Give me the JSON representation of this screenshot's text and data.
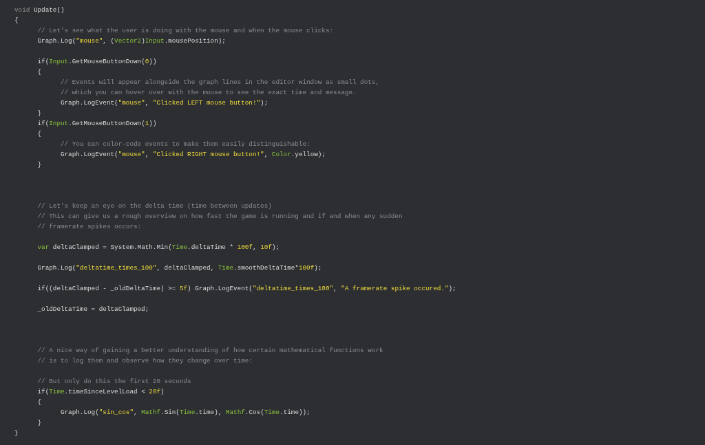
{
  "editor": {
    "lines": [
      {
        "kind": "code",
        "tokens": [
          {
            "kind": "keyword",
            "text": "void"
          },
          {
            "kind": "plain",
            "text": " Update()"
          }
        ]
      },
      {
        "kind": "code",
        "tokens": [
          {
            "kind": "plain",
            "text": "{"
          }
        ]
      },
      {
        "kind": "code",
        "tokens": [
          {
            "kind": "comment",
            "text": "\t// Let's see what the user is doing with the mouse and when the mouse clicks:"
          }
        ]
      },
      {
        "kind": "code",
        "tokens": [
          {
            "kind": "plain",
            "text": "\tGraph.Log("
          },
          {
            "kind": "string",
            "text": "\"mouse\""
          },
          {
            "kind": "plain",
            "text": ", ("
          },
          {
            "kind": "type",
            "text": "Vector2"
          },
          {
            "kind": "plain",
            "text": ")"
          },
          {
            "kind": "type",
            "text": "Input"
          },
          {
            "kind": "plain",
            "text": ".mousePosition);"
          }
        ]
      },
      {
        "kind": "blank"
      },
      {
        "kind": "code",
        "tokens": [
          {
            "kind": "plain",
            "text": "\tif("
          },
          {
            "kind": "type",
            "text": "Input"
          },
          {
            "kind": "plain",
            "text": ".GetMouseButtonDown("
          },
          {
            "kind": "number",
            "text": "0"
          },
          {
            "kind": "plain",
            "text": "))"
          }
        ]
      },
      {
        "kind": "code",
        "tokens": [
          {
            "kind": "plain",
            "text": "\t{"
          }
        ]
      },
      {
        "kind": "code",
        "tokens": [
          {
            "kind": "comment",
            "text": "\t\t// Events will appear alongside the graph lines in the editor window as small dots,"
          }
        ]
      },
      {
        "kind": "code",
        "tokens": [
          {
            "kind": "comment",
            "text": "\t\t// which you can hover over with the mouse to see the exact time and message."
          }
        ]
      },
      {
        "kind": "code",
        "tokens": [
          {
            "kind": "plain",
            "text": "\t\tGraph.LogEvent("
          },
          {
            "kind": "string",
            "text": "\"mouse\""
          },
          {
            "kind": "plain",
            "text": ", "
          },
          {
            "kind": "string",
            "text": "\"Clicked LEFT mouse button!\""
          },
          {
            "kind": "plain",
            "text": ");"
          }
        ]
      },
      {
        "kind": "code",
        "tokens": [
          {
            "kind": "plain",
            "text": "\t}"
          }
        ]
      },
      {
        "kind": "code",
        "tokens": [
          {
            "kind": "plain",
            "text": "\tif("
          },
          {
            "kind": "type",
            "text": "Input"
          },
          {
            "kind": "plain",
            "text": ".GetMouseButtonDown("
          },
          {
            "kind": "number",
            "text": "1"
          },
          {
            "kind": "plain",
            "text": "))"
          }
        ]
      },
      {
        "kind": "code",
        "tokens": [
          {
            "kind": "plain",
            "text": "\t{"
          }
        ]
      },
      {
        "kind": "code",
        "tokens": [
          {
            "kind": "comment",
            "text": "\t\t// You can color-code events to make them easily distinguishable:"
          }
        ]
      },
      {
        "kind": "code",
        "tokens": [
          {
            "kind": "plain",
            "text": "\t\tGraph.LogEvent("
          },
          {
            "kind": "string",
            "text": "\"mouse\""
          },
          {
            "kind": "plain",
            "text": ", "
          },
          {
            "kind": "string",
            "text": "\"Clicked RIGHT mouse button!\""
          },
          {
            "kind": "plain",
            "text": ", "
          },
          {
            "kind": "type",
            "text": "Color"
          },
          {
            "kind": "plain",
            "text": ".yellow);"
          }
        ]
      },
      {
        "kind": "code",
        "tokens": [
          {
            "kind": "plain",
            "text": "\t}"
          }
        ]
      },
      {
        "kind": "blank"
      },
      {
        "kind": "blank"
      },
      {
        "kind": "blank"
      },
      {
        "kind": "code",
        "tokens": [
          {
            "kind": "comment",
            "text": "\t// Let's keep an eye on the delta time (time between updates)"
          }
        ]
      },
      {
        "kind": "code",
        "tokens": [
          {
            "kind": "comment",
            "text": "\t// This can give us a rough overview on how fast the game is running and if and when any sudden"
          }
        ]
      },
      {
        "kind": "code",
        "tokens": [
          {
            "kind": "comment",
            "text": "\t// framerate spikes occurs:"
          }
        ]
      },
      {
        "kind": "blank"
      },
      {
        "kind": "code",
        "tokens": [
          {
            "kind": "type",
            "text": "\tvar"
          },
          {
            "kind": "plain",
            "text": " deltaClamped = System.Math.Min("
          },
          {
            "kind": "type",
            "text": "Time"
          },
          {
            "kind": "plain",
            "text": ".deltaTime * "
          },
          {
            "kind": "number",
            "text": "100f"
          },
          {
            "kind": "plain",
            "text": ", "
          },
          {
            "kind": "number",
            "text": "10f"
          },
          {
            "kind": "plain",
            "text": ");"
          }
        ]
      },
      {
        "kind": "blank"
      },
      {
        "kind": "code",
        "tokens": [
          {
            "kind": "plain",
            "text": "\tGraph.Log("
          },
          {
            "kind": "string",
            "text": "\"deltatime_times_100\""
          },
          {
            "kind": "plain",
            "text": ", deltaClamped, "
          },
          {
            "kind": "type",
            "text": "Time"
          },
          {
            "kind": "plain",
            "text": ".smoothDeltaTime*"
          },
          {
            "kind": "number",
            "text": "100f"
          },
          {
            "kind": "plain",
            "text": ");"
          }
        ]
      },
      {
        "kind": "blank"
      },
      {
        "kind": "code",
        "tokens": [
          {
            "kind": "plain",
            "text": "\tif((deltaClamped - _oldDeltaTime) >= "
          },
          {
            "kind": "number",
            "text": "5f"
          },
          {
            "kind": "plain",
            "text": ") Graph.LogEvent("
          },
          {
            "kind": "string",
            "text": "\"deltatime_times_100\""
          },
          {
            "kind": "plain",
            "text": ", "
          },
          {
            "kind": "string",
            "text": "\"A framerate spike occured.\""
          },
          {
            "kind": "plain",
            "text": ");"
          }
        ]
      },
      {
        "kind": "blank"
      },
      {
        "kind": "code",
        "tokens": [
          {
            "kind": "plain",
            "text": "\t_oldDeltaTime = deltaClamped;"
          }
        ]
      },
      {
        "kind": "blank"
      },
      {
        "kind": "blank"
      },
      {
        "kind": "blank"
      },
      {
        "kind": "code",
        "tokens": [
          {
            "kind": "comment",
            "text": "\t// A nice way of gaining a better understanding of how certain mathematical functions work"
          }
        ]
      },
      {
        "kind": "code",
        "tokens": [
          {
            "kind": "comment",
            "text": "\t// is to log them and observe how they change over time:"
          }
        ]
      },
      {
        "kind": "blank"
      },
      {
        "kind": "code",
        "tokens": [
          {
            "kind": "comment",
            "text": "\t// But only do this the first 20 seconds"
          }
        ]
      },
      {
        "kind": "code",
        "tokens": [
          {
            "kind": "plain",
            "text": "\tif("
          },
          {
            "kind": "type",
            "text": "Time"
          },
          {
            "kind": "plain",
            "text": ".timeSinceLevelLoad < "
          },
          {
            "kind": "number",
            "text": "20f"
          },
          {
            "kind": "plain",
            "text": ")"
          }
        ]
      },
      {
        "kind": "code",
        "tokens": [
          {
            "kind": "plain",
            "text": "\t{"
          }
        ]
      },
      {
        "kind": "code",
        "tokens": [
          {
            "kind": "plain",
            "text": "\t\tGraph.Log("
          },
          {
            "kind": "string",
            "text": "\"sin_cos\""
          },
          {
            "kind": "plain",
            "text": ", "
          },
          {
            "kind": "type",
            "text": "Mathf"
          },
          {
            "kind": "plain",
            "text": ".Sin("
          },
          {
            "kind": "type",
            "text": "Time"
          },
          {
            "kind": "plain",
            "text": ".time), "
          },
          {
            "kind": "type",
            "text": "Mathf"
          },
          {
            "kind": "plain",
            "text": ".Cos("
          },
          {
            "kind": "type",
            "text": "Time"
          },
          {
            "kind": "plain",
            "text": ".time));"
          }
        ]
      },
      {
        "kind": "code",
        "tokens": [
          {
            "kind": "plain",
            "text": "\t}"
          }
        ]
      },
      {
        "kind": "code",
        "tokens": [
          {
            "kind": "plain",
            "text": "}"
          }
        ]
      }
    ]
  }
}
